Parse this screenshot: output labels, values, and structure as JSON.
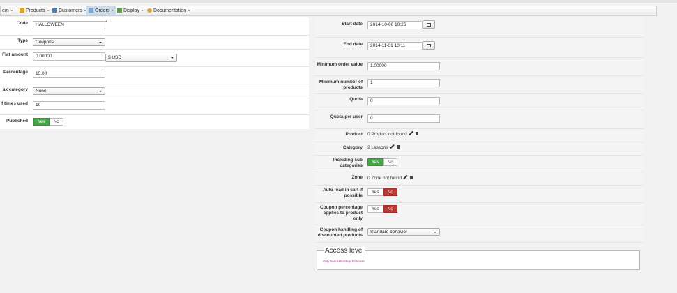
{
  "menu": {
    "items": [
      {
        "label": "em",
        "icon": "system-icon",
        "color": "#cc8b2c"
      },
      {
        "label": "Products",
        "icon": "products-icon",
        "color": "#e6a21c"
      },
      {
        "label": "Customers",
        "icon": "customers-icon",
        "color": "#4b7fb8"
      },
      {
        "label": "Orders",
        "icon": "orders-icon",
        "color": "#7aa7d6"
      },
      {
        "label": "Display",
        "icon": "display-icon",
        "color": "#5e9e4a"
      },
      {
        "label": "Documentation",
        "icon": "documentation-icon",
        "color": "#e3a33c"
      }
    ],
    "active": "Orders"
  },
  "left": {
    "code": {
      "label": "Code",
      "value": "HALLOWEEN",
      "required_mark": "*"
    },
    "type": {
      "label": "Type",
      "value": "Coupons"
    },
    "flat_amount": {
      "label": "Flat amount",
      "value": "0.00000",
      "currency": "$ USD"
    },
    "percentage": {
      "label": "Percentage",
      "value": "15.00"
    },
    "tax_category": {
      "label": "ax category",
      "value": "None"
    },
    "times_used": {
      "label": "f times used",
      "value": "10"
    },
    "published": {
      "label": "Published",
      "yes": "Yes",
      "no": "No",
      "selected": "yes"
    }
  },
  "right": {
    "start_date": {
      "label": "Start date",
      "value": "2014-10-06 10:26"
    },
    "end_date": {
      "label": "End date",
      "value": "2014-11-01 10:11"
    },
    "min_order": {
      "label": "Minimum order value",
      "value": "1.00000"
    },
    "min_products": {
      "label": "Minimum number of products",
      "value": "1"
    },
    "quota": {
      "label": "Quota",
      "value": "0"
    },
    "quota_user": {
      "label": "Quota per user",
      "value": "0"
    },
    "product": {
      "label": "Product",
      "value": "0 Product not found"
    },
    "category": {
      "label": "Category",
      "value": "2 Lessons"
    },
    "including_sub": {
      "label": "Including sub categories",
      "yes": "Yes",
      "no": "No",
      "selected": "yes"
    },
    "zone": {
      "label": "Zone",
      "value": "0 Zone not found"
    },
    "auto_load": {
      "label": "Auto load in cart if possible",
      "yes": "Yes",
      "no": "No",
      "selected": "no"
    },
    "coupon_pct": {
      "label": "Coupon percentage applies to product only",
      "yes": "Yes",
      "no": "No",
      "selected": "no"
    },
    "coupon_handling": {
      "label": "Coupon handling of discounted products",
      "value": "Standard behavior"
    }
  },
  "access": {
    "legend": "Access level",
    "note": "Only from HikaShop Business"
  },
  "colors": {
    "yes_active": "#46a546",
    "no_active": "#bd362f",
    "accent_note": "#b0228c"
  }
}
